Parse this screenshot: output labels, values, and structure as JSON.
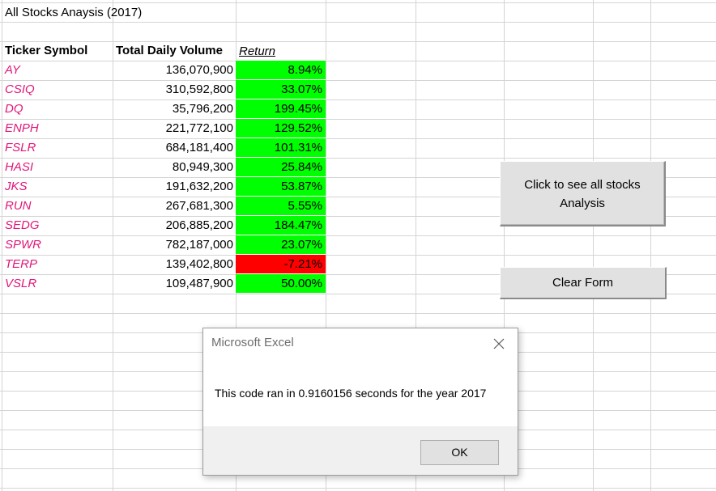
{
  "sheet": {
    "title": "All Stocks Anaysis (2017)",
    "headers": {
      "ticker": "Ticker Symbol",
      "volume": "Total Daily Volume",
      "return": "Return"
    },
    "rows": [
      {
        "ticker": "AY",
        "volume": "136,070,900",
        "return": "8.94%",
        "positive": true
      },
      {
        "ticker": "CSIQ",
        "volume": "310,592,800",
        "return": "33.07%",
        "positive": true
      },
      {
        "ticker": "DQ",
        "volume": "35,796,200",
        "return": "199.45%",
        "positive": true
      },
      {
        "ticker": "ENPH",
        "volume": "221,772,100",
        "return": "129.52%",
        "positive": true
      },
      {
        "ticker": "FSLR",
        "volume": "684,181,400",
        "return": "101.31%",
        "positive": true
      },
      {
        "ticker": "HASI",
        "volume": "80,949,300",
        "return": "25.84%",
        "positive": true
      },
      {
        "ticker": "JKS",
        "volume": "191,632,200",
        "return": "53.87%",
        "positive": true
      },
      {
        "ticker": "RUN",
        "volume": "267,681,300",
        "return": "5.55%",
        "positive": true
      },
      {
        "ticker": "SEDG",
        "volume": "206,885,200",
        "return": "184.47%",
        "positive": true
      },
      {
        "ticker": "SPWR",
        "volume": "782,187,000",
        "return": "23.07%",
        "positive": true
      },
      {
        "ticker": "TERP",
        "volume": "139,402,800",
        "return": "-7.21%",
        "positive": false
      },
      {
        "ticker": "VSLR",
        "volume": "109,487,900",
        "return": "50.00%",
        "positive": true
      }
    ]
  },
  "buttons": {
    "analysis_line1": "Click to see all stocks",
    "analysis_line2": "Analysis",
    "clear": "Clear Form"
  },
  "dialog": {
    "title": "Microsoft Excel",
    "message": "This code ran in 0.9160156 seconds for the year 2017",
    "ok": "OK",
    "close_icon": "close-icon"
  },
  "colors": {
    "positive": "#00ff00",
    "negative": "#ff0000",
    "ticker_text": "#e0177a",
    "gridline": "#d4d4d4"
  }
}
